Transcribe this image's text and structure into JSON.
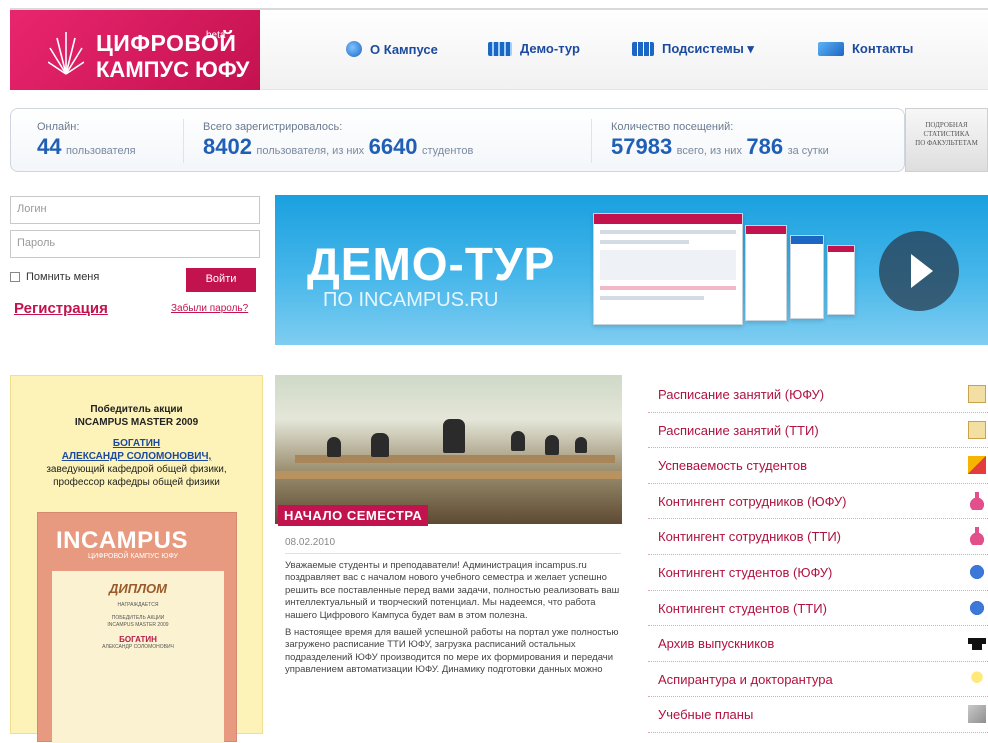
{
  "header": {
    "logo": {
      "line1": "ЦИФРОВОЙ",
      "superscript": "beta",
      "line2": "КАМПУС ЮФУ"
    },
    "nav": [
      {
        "label": "О Кампусе",
        "icon": "globe-icon"
      },
      {
        "label": "Демо-тур",
        "icon": "film-icon"
      },
      {
        "label": "Подсистемы ▾",
        "icon": "grid-icon"
      },
      {
        "label": "Контакты",
        "icon": "envelope-icon"
      }
    ]
  },
  "stats": {
    "online": {
      "label": "Онлайн:",
      "value": "44",
      "unit": "пользователя"
    },
    "registered": {
      "label": "Всего зарегистрировалось:",
      "value": "8402",
      "unit": "пользователя, из них",
      "students_value": "6640",
      "students_unit": "студентов"
    },
    "visits": {
      "label": "Количество посещений:",
      "value": "57983",
      "unit": "всего, из них",
      "daily_value": "786",
      "daily_unit": "за сутки"
    },
    "faculty_link": {
      "line1": "ПОДРОБНАЯ",
      "line2": "СТАТИСТИКА",
      "line3": "ПО ФАКУЛЬТЕТАМ"
    }
  },
  "login": {
    "login_placeholder": "Логин",
    "password_placeholder": "Пароль",
    "remember_label": "Помнить меня",
    "submit_label": "Войти",
    "register_label": "Регистрация",
    "forgot_label": "Забыли пароль?"
  },
  "banner": {
    "title": "ДЕМО-ТУР",
    "subtitle": "ПО INCAMPUS.RU"
  },
  "winner": {
    "title_line1": "Победитель акции",
    "title_line2": "INCAMPUS MASTER 2009",
    "name_line1": "БОГАТИН",
    "name_line2": "АЛЕКСАНДР СОЛОМОНОВИЧ,",
    "desc_line1": "заведующий кафедрой общей физики,",
    "desc_line2": "профессор кафедры общей физики",
    "diploma": {
      "brand": "INCAMPUS",
      "brand_sub": "ЦИФРОВОЙ КАМПУС ЮФУ",
      "heading": "ДИПЛОМ",
      "awarded": "НАГРАЖДАЕТСЯ",
      "text1": "ПОБЕДИТЕЛЬ АКЦИИ",
      "text2": "INCAMPUS MASTER 2009",
      "name1": "БОГАТИН",
      "name2": "АЛЕКСАНДР СОЛОМОНОВИЧ"
    }
  },
  "news": {
    "tag": "НАЧАЛО СЕМЕСТРА",
    "date": "08.02.2010",
    "p1": "Уважаемые студенты и преподаватели! Администрация incampus.ru поздравляет вас с началом нового учебного семестра и желает успешно решить все поставленные перед вами задачи, полностью реализовать ваш интеллектуальный и творческий потенциал. Мы надеемся, что работа нашего Цифрового Кампуса будет вам в этом полезна.",
    "p2": "В настоящее время для вашей успешной работы на портал уже полностью загружено расписание ТТИ ЮФУ, загрузка расписаний остальных подразделений ЮФУ производится по мере их формирования и передачи управлением автоматизации ЮФУ. Динамику подготовки данных можно"
  },
  "links": [
    {
      "label": "Расписание занятий (ЮФУ)",
      "icon": "calendar-icon"
    },
    {
      "label": "Расписание занятий (ТТИ)",
      "icon": "calendar-icon"
    },
    {
      "label": "Успеваемость студентов",
      "icon": "grades-icon"
    },
    {
      "label": "Контингент сотрудников (ЮФУ)",
      "icon": "staff-icon"
    },
    {
      "label": "Контингент сотрудников (ТТИ)",
      "icon": "staff-icon"
    },
    {
      "label": "Контингент студентов (ЮФУ)",
      "icon": "students-icon"
    },
    {
      "label": "Контингент студентов (ТТИ)",
      "icon": "students-icon"
    },
    {
      "label": "Архив выпускников",
      "icon": "graduation-cap-icon"
    },
    {
      "label": "Аспирантура и докторантура",
      "icon": "lightbulb-icon"
    },
    {
      "label": "Учебные планы",
      "icon": "book-icon"
    }
  ],
  "colors": {
    "brand": "#c2134e",
    "nav_text": "#1b4a9e",
    "stat_number": "#1f5fb6",
    "banner": "#1aa0df"
  }
}
